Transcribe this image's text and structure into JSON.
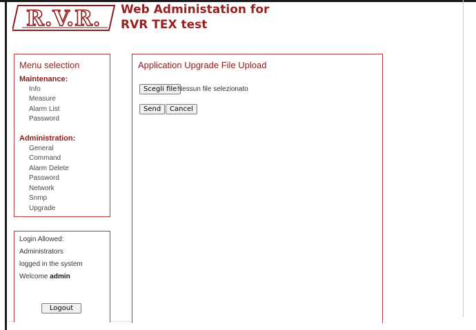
{
  "header": {
    "logo_text": "R.V.R.",
    "title_line1": "Web Administation for",
    "title_line2": "RVR TEX test"
  },
  "menu": {
    "title": "Menu selection",
    "maintenance_heading": "Maintenance:",
    "maintenance_items": [
      "Info",
      "Measure",
      "Alarm List",
      "Password"
    ],
    "administration_heading": "Administration:",
    "administration_items": [
      "General",
      "Command",
      "Alarm Delete",
      "Password",
      "Network",
      "Snmp",
      "Upgrade"
    ]
  },
  "login": {
    "line1": "Login Allowed:",
    "line2": "Administrators",
    "line3": "logged in the system",
    "welcome": "Welcome",
    "user": "admin",
    "logout_label": "Logout"
  },
  "upload": {
    "title": "Application Upgrade File Upload",
    "choose_label": "Scegli file",
    "no_file_text": "Nessun file selezionato",
    "send_label": "Send",
    "cancel_label": "Cancel"
  },
  "colors": {
    "accent": "#9a1f1f",
    "border": "#b03a3a"
  }
}
